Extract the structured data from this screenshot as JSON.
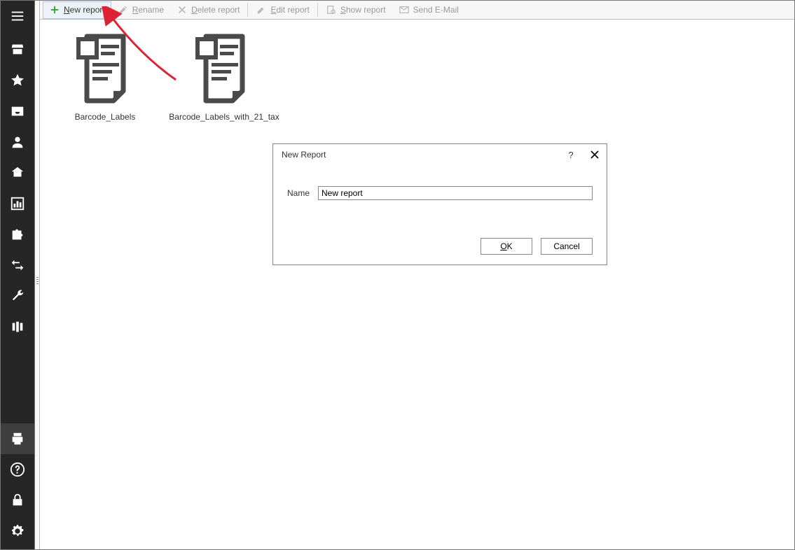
{
  "toolbar": {
    "new_report": "New report",
    "rename": "Rename",
    "delete_report": "Delete report",
    "edit_report": "Edit report",
    "show_report": "Show report",
    "send_email": "Send E-Mail"
  },
  "reports": [
    {
      "label": "Barcode_Labels"
    },
    {
      "label": "Barcode_Labels_with_21_tax"
    }
  ],
  "dialog": {
    "title": "New Report",
    "name_label": "Name",
    "name_value": "New report",
    "ok": "OK",
    "cancel": "Cancel",
    "help": "?"
  }
}
